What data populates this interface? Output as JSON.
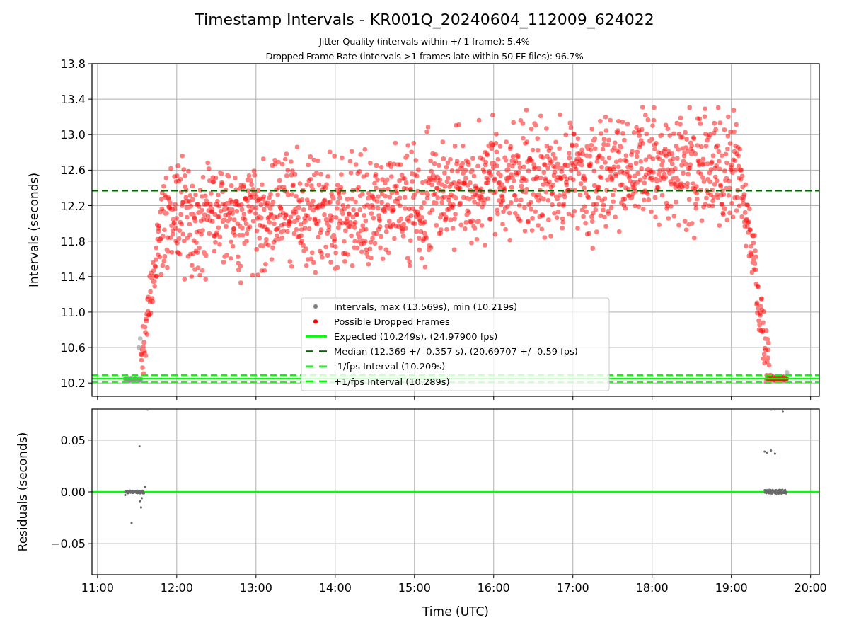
{
  "figure": {
    "title": "Timestamp Intervals - KR001Q_20240604_112009_624022",
    "subtitles": [
      "Jitter Quality (intervals within +/-1 frame): 5.4%",
      "Dropped Frame Rate (intervals >1 frames late within 50 FF files): 96.7%"
    ]
  },
  "intervals_plot": {
    "ylabel": "Intervals (seconds)",
    "ytick_labels": [
      "13.8",
      "13.4",
      "13.0",
      "12.6",
      "12.2",
      "11.8",
      "11.4",
      "11.0",
      "10.6",
      "10.2"
    ],
    "legend": [
      {
        "label": "Intervals, max (13.569s), min (10.219s)",
        "color": "#808080",
        "kind": "marker"
      },
      {
        "label": "Possible Dropped Frames",
        "color": "#ff0000",
        "kind": "marker"
      },
      {
        "label": "Expected (10.249s), (24.97900 fps)",
        "color": "#00ff00",
        "kind": "solid_line"
      },
      {
        "label": "Median (12.369 +/- 0.357 s), (20.69707 +/- 0.59 fps)",
        "color": "#006400",
        "kind": "dashed_line"
      },
      {
        "label": "-1/fps Interval (10.209s)",
        "color": "#32e632",
        "kind": "dashed_line"
      },
      {
        "label": "+1/fps Interval (10.289s)",
        "color": "#00ff00",
        "kind": "dashed_line"
      }
    ]
  },
  "residuals_plot": {
    "chart_data": {
      "type": "line",
      "xlabel": "Time (UTC)",
      "ylabel": "Residuals (seconds)",
      "xlim": [
        10.93,
        20.11
      ],
      "ylim": [
        -0.08,
        0.08
      ],
      "grid": true,
      "xticks": [
        {
          "value": 11,
          "label": "11:00"
        },
        {
          "value": 12,
          "label": "12:00"
        },
        {
          "value": 13,
          "label": "13:00"
        },
        {
          "value": 14,
          "label": "14:00"
        },
        {
          "value": 15,
          "label": "15:00"
        },
        {
          "value": 16,
          "label": "16:00"
        },
        {
          "value": 17,
          "label": "17:00"
        },
        {
          "value": 18,
          "label": "18:00"
        },
        {
          "value": 19,
          "label": "19:00"
        },
        {
          "value": 20,
          "label": "20:00"
        }
      ],
      "yticks": [
        {
          "value": 0.05,
          "label": "0.05"
        },
        {
          "value": 0,
          "label": "0.00"
        },
        {
          "value": -0.05,
          "label": "−0.05"
        }
      ],
      "series": [
        {
          "color": "#00ff00",
          "x": [
            10.93,
            20.11
          ],
          "values": [
            0,
            0
          ]
        }
      ]
    }
  }
}
